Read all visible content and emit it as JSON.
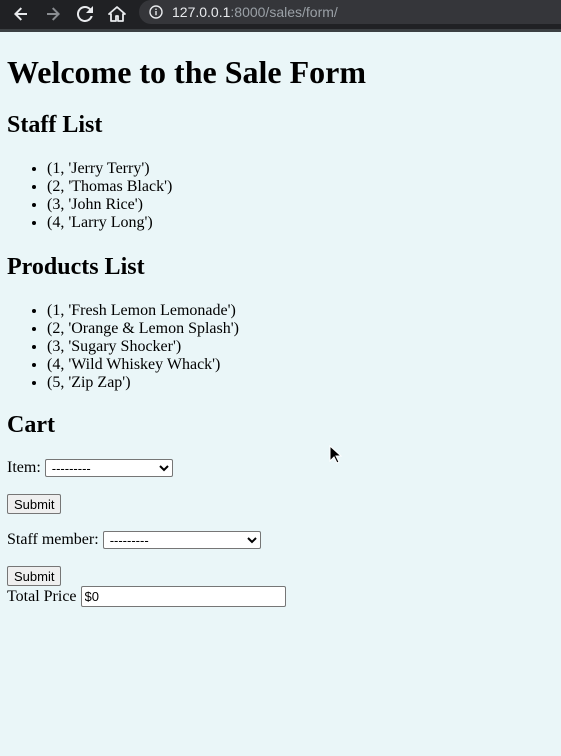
{
  "browser": {
    "url_host": "127.0.0.1",
    "url_path": ":8000/sales/form/",
    "icons": [
      "back-arrow-icon",
      "forward-arrow-icon",
      "reload-icon",
      "home-icon",
      "info-icon"
    ]
  },
  "page": {
    "title": "Welcome to the Sale Form",
    "staff_heading": "Staff List",
    "staff": [
      "(1, 'Jerry Terry')",
      "(2, 'Thomas Black')",
      "(3, 'John Rice')",
      "(4, 'Larry Long')"
    ],
    "products_heading": "Products List",
    "products": [
      "(1, 'Fresh Lemon Lemonade')",
      "(2, 'Orange & Lemon Splash')",
      "(3, 'Sugary Shocker')",
      "(4, 'Wild Whiskey Whack')",
      "(5, 'Zip Zap')"
    ],
    "cart_heading": "Cart",
    "item_label": "Item:",
    "item_selected": "---------",
    "submit_label": "Submit",
    "staff_label": "Staff member:",
    "staff_selected": "---------",
    "total_label": "Total Price",
    "total_value": "$0"
  },
  "colors": {
    "page_background": "#eaf6f8",
    "browser_bar": "#202124"
  }
}
